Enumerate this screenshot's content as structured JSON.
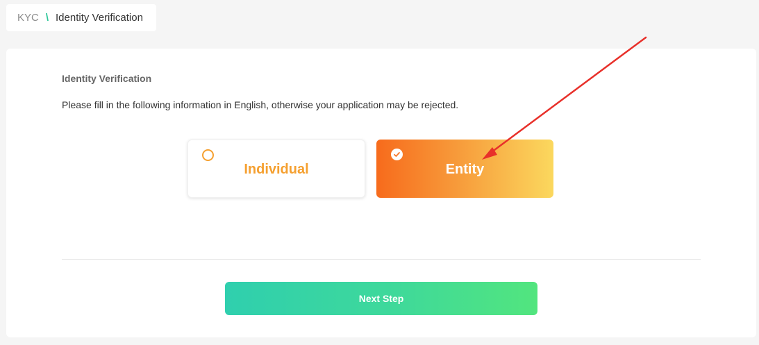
{
  "breadcrumb": {
    "root": "KYC",
    "separator": "\\",
    "current": "Identity Verification"
  },
  "form": {
    "title": "Identity Verification",
    "notice": "Please fill in the following information in English, otherwise your application may be rejected.",
    "options": [
      {
        "label": "Individual",
        "selected": false
      },
      {
        "label": "Entity",
        "selected": true
      }
    ],
    "next_button": "Next Step"
  },
  "colors": {
    "accent_green": "#2fc79a",
    "option_orange": "#f5a030",
    "annotation_arrow": "#e8302a"
  },
  "icons": {
    "unselected": "radio-empty-icon",
    "selected": "check-circle-icon",
    "annotation": "red-arrow-icon"
  }
}
